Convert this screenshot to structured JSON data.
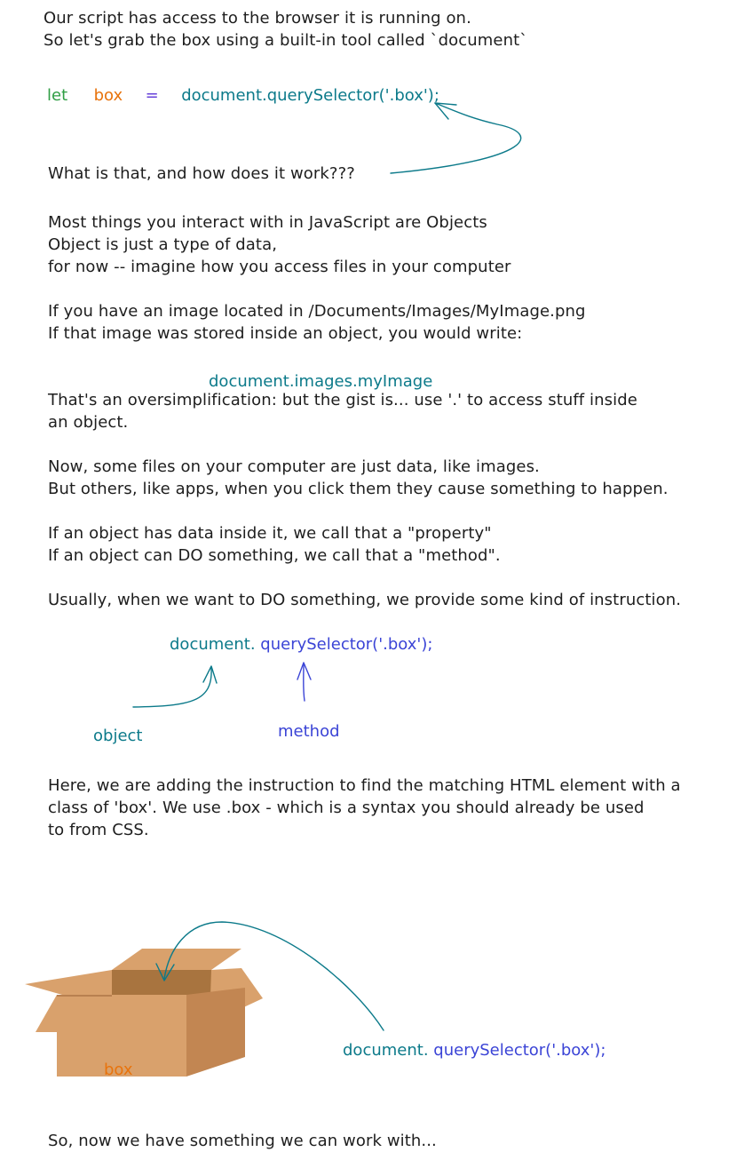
{
  "colors": {
    "text": "#1e1e1e",
    "teal": "#0c7a8a",
    "green": "#2f9e44",
    "orange": "#e8730c",
    "purple": "#6741d9",
    "blue": "#3b44d6",
    "box_front": "#d9a16c",
    "box_side": "#c28652",
    "box_inside": "#a8743f"
  },
  "intro": {
    "line1": "Our script has access to the browser it is running on.",
    "line2": "So let's grab the box using a built-in tool called `document`"
  },
  "code_line": {
    "keyword": "let",
    "variable": "box",
    "equals": "=",
    "expression": "document.querySelector('.box');"
  },
  "question": "What is that, and how does it work???",
  "objects_para": {
    "line1": "Most things you interact with in JavaScript are Objects",
    "line2": "Object is just a type of data,",
    "line3": "for now -- imagine how you access files in your computer"
  },
  "image_para": {
    "line1": "If you have an image located in /Documents/Images/MyImage.png",
    "line2": "If that image was stored inside an object, you would write:"
  },
  "image_code": "document.images.myImage",
  "gist_para": {
    "line1": "That's an oversimplification: but the gist is... use '.' to access stuff inside",
    "line2": "an object."
  },
  "files_para": {
    "line1": "Now, some files on your computer are just data, like images.",
    "line2": "But others, like apps, when you click them they cause something to happen."
  },
  "property_para": {
    "line1": "If an object has data inside it, we call that a \"property\"",
    "line2": "If an object can DO something, we call that a \"method\"."
  },
  "instruction_line": "Usually, when we want to DO something, we provide some kind of instruction.",
  "diagram_code": {
    "object_part": "document.",
    "method_part": "querySelector('.box');"
  },
  "labels": {
    "object": "object",
    "method": "method"
  },
  "html_para": {
    "line1": "Here, we are adding the instruction to find the matching HTML element with a",
    "line2": "class of 'box'. We use .box - which is a syntax you should already be used",
    "line3": "to from CSS."
  },
  "box_label": "box",
  "bottom_code": {
    "object_part": "document.",
    "method_part": "querySelector('.box');"
  },
  "closing": "So, now we have something we can work with..."
}
